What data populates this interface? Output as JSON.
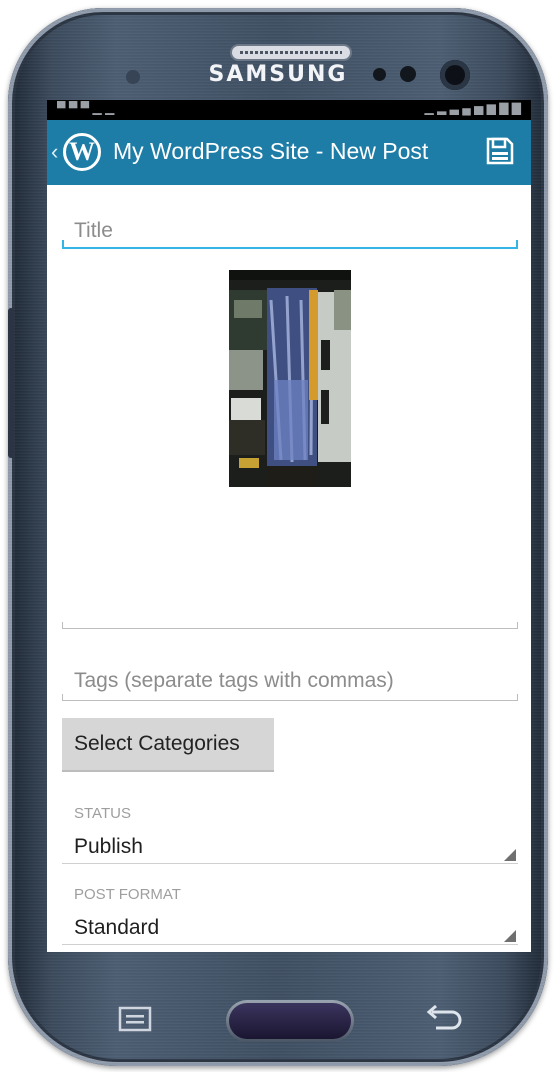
{
  "device": {
    "brand": "SAMSUNG"
  },
  "statusbar": {
    "left_text": "▀ ▀ ▀  ▁  ▁",
    "right_text": "▁ ▂ ▃ ▄ ▅  ▆ ▇ ▇"
  },
  "actionbar": {
    "title": "My WordPress Site - New Post",
    "back_glyph": "‹",
    "logo_glyph": "W",
    "color": "#1e7da7"
  },
  "editor": {
    "title_placeholder": "Title",
    "tags_placeholder": "Tags (separate tags with commas)",
    "select_categories_label": "Select Categories"
  },
  "status": {
    "label": "STATUS",
    "value": "Publish"
  },
  "post_format": {
    "label": "POST FORMAT",
    "value": "Standard"
  },
  "icons": {
    "save": "save-icon",
    "back": "chevron-left-icon",
    "logo": "wordpress-logo-icon",
    "menu": "menu-key-icon",
    "back_key": "back-arrow-icon"
  },
  "accent_color": "#33b5e5"
}
